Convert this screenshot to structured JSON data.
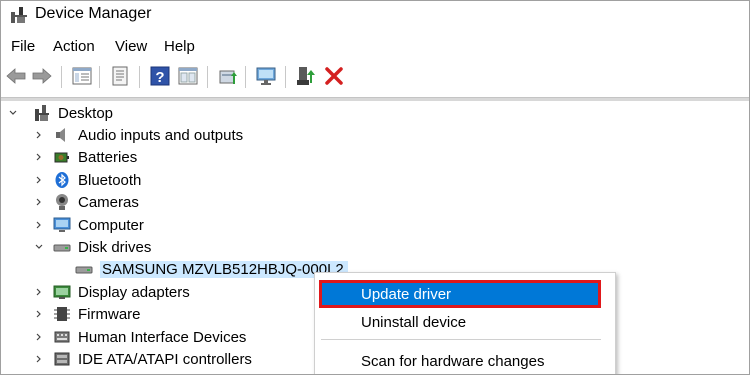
{
  "window": {
    "title": "Device Manager"
  },
  "menu": [
    "File",
    "Action",
    "View",
    "Help"
  ],
  "toolbar": {
    "buttons": [
      "back-arrow-icon",
      "forward-arrow-icon",
      "properties-pane-icon",
      "properties-sheet-icon",
      "help-icon",
      "console-view-icon",
      "update-driver-icon",
      "scan-monitor-icon",
      "enable-device-icon",
      "uninstall-x-icon"
    ]
  },
  "tree": {
    "root": "Desktop",
    "items": [
      {
        "label": "Audio inputs and outputs",
        "icon": "speaker-icon",
        "expanded": false
      },
      {
        "label": "Batteries",
        "icon": "battery-icon",
        "expanded": false
      },
      {
        "label": "Bluetooth",
        "icon": "bluetooth-icon",
        "expanded": false
      },
      {
        "label": "Cameras",
        "icon": "camera-icon",
        "expanded": false
      },
      {
        "label": "Computer",
        "icon": "monitor-icon",
        "expanded": false
      },
      {
        "label": "Disk drives",
        "icon": "disk-drive-icon",
        "expanded": true
      },
      {
        "label": "SAMSUNG MZVLB512HBJQ-000L2",
        "icon": "disk-drive-icon",
        "child": true,
        "selected": true
      },
      {
        "label": "Display adapters",
        "icon": "display-adapter-icon",
        "expanded": false
      },
      {
        "label": "Firmware",
        "icon": "chip-icon",
        "expanded": false
      },
      {
        "label": "Human Interface Devices",
        "icon": "hid-icon",
        "expanded": false
      },
      {
        "label": "IDE ATA/ATAPI controllers",
        "icon": "controller-icon",
        "expanded": false
      }
    ]
  },
  "context_menu": {
    "items": [
      {
        "label": "Update driver",
        "highlighted": true
      },
      {
        "label": "Uninstall device"
      },
      {
        "label": "Scan for hardware changes"
      }
    ]
  },
  "colors": {
    "selection": "#cce8ff",
    "menu_highlight": "#0078d7",
    "outline": "#e0181b"
  }
}
